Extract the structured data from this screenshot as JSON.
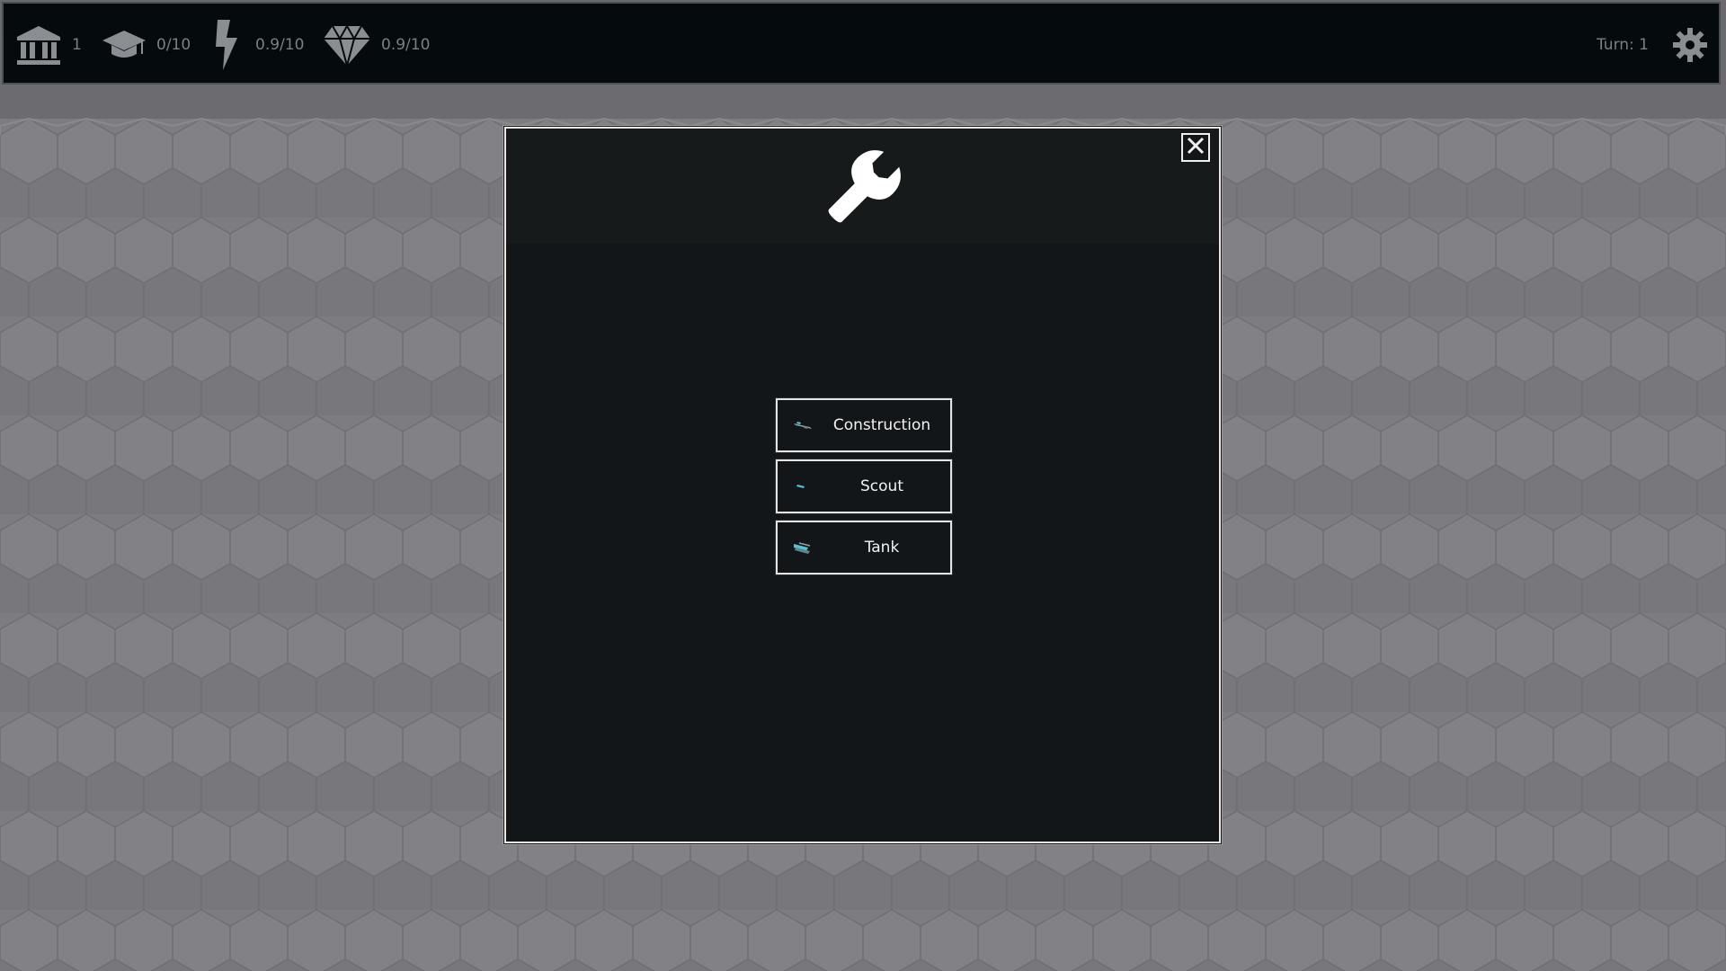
{
  "hud": {
    "cities": {
      "icon": "bank-icon",
      "value": "1"
    },
    "science": {
      "icon": "graduation-cap-icon",
      "value": "0/10"
    },
    "energy": {
      "icon": "lightning-icon",
      "value": "0.9/10"
    },
    "gems": {
      "icon": "diamond-icon",
      "value": "0.9/10"
    },
    "turn_label": "Turn: 1",
    "settings_icon": "gear-icon"
  },
  "modal": {
    "header_icon": "wrench-icon",
    "close_icon": "close-icon",
    "options": [
      {
        "label": "Construction",
        "icon": "construction-unit-icon"
      },
      {
        "label": "Scout",
        "icon": "scout-unit-icon"
      },
      {
        "label": "Tank",
        "icon": "tank-unit-icon"
      }
    ]
  },
  "colors": {
    "hud_bg": "#050a0c",
    "hud_text": "#7c8084",
    "modal_bg": "#121618",
    "modal_border": "#e8e8e8",
    "terrain": "#7b7b7f",
    "unit_accent": "#4fc3d9"
  }
}
